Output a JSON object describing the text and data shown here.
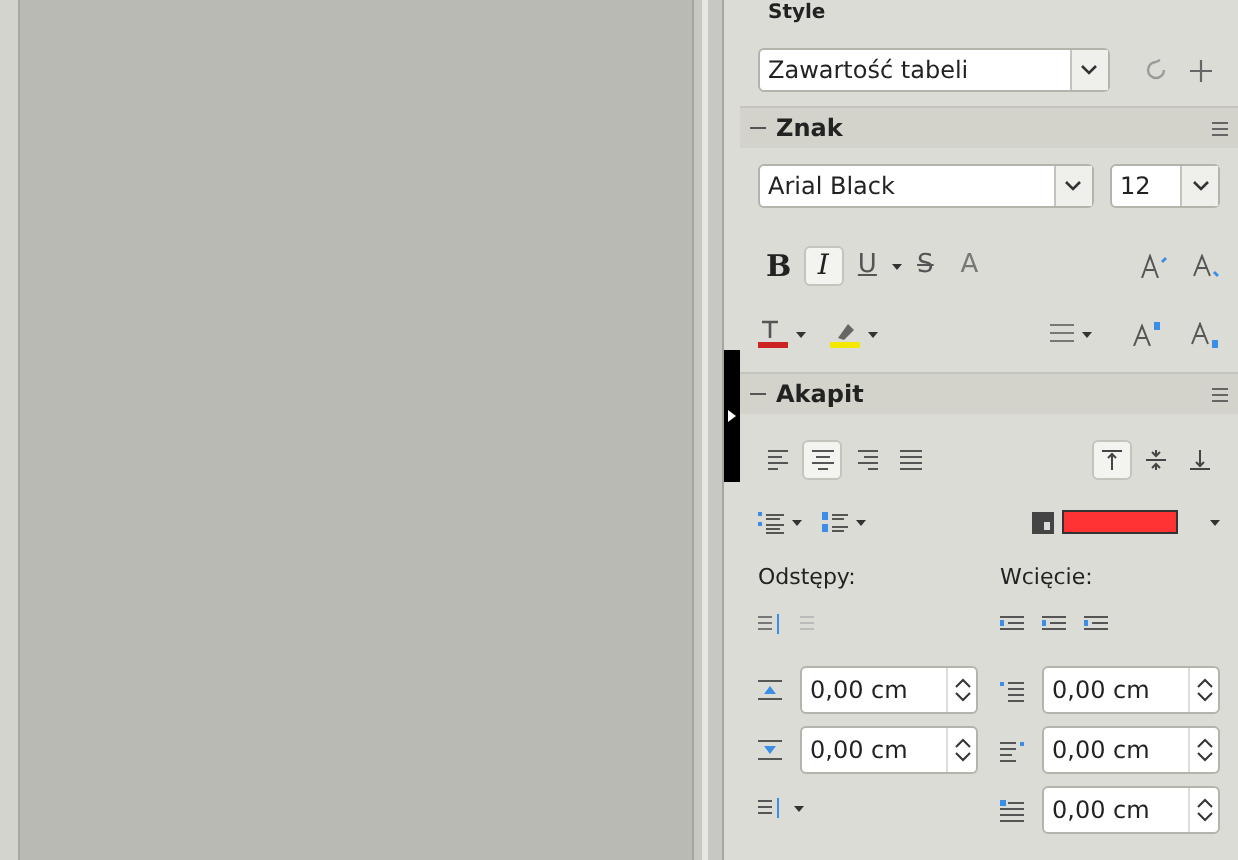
{
  "style_section": {
    "title": "Style",
    "value": "Zawartość tabeli"
  },
  "character": {
    "title": "Znak",
    "font": "Arial Black",
    "size": "12",
    "format_buttons": [
      {
        "kind": "bold",
        "label": "B",
        "selected": false
      },
      {
        "kind": "italic",
        "label": "I",
        "selected": true
      },
      {
        "kind": "underline",
        "label": "U",
        "selected": false
      },
      {
        "kind": "strike",
        "label": "S",
        "selected": false
      },
      {
        "kind": "shadow",
        "label": "A",
        "selected": false
      }
    ],
    "font_color": {
      "color": "#cc2222"
    },
    "highlight_color": {
      "color": "#f5e800"
    }
  },
  "paragraph": {
    "title": "Akapit",
    "alignment": [
      {
        "kind": "left",
        "selected": false
      },
      {
        "kind": "center",
        "selected": true
      },
      {
        "kind": "right",
        "selected": false
      },
      {
        "kind": "justify",
        "selected": false
      }
    ],
    "vertical_alignment": [
      {
        "kind": "top",
        "selected": true
      },
      {
        "kind": "middle",
        "selected": false
      },
      {
        "kind": "bottom",
        "selected": false
      }
    ],
    "background_color": {
      "color": "#ff3333"
    },
    "spacing_label": "Odstępy:",
    "indent_label": "Wcięcie:",
    "spacing_fields": [
      {
        "kind": "above",
        "value": "0,00 cm"
      },
      {
        "kind": "below",
        "value": "0,00 cm"
      }
    ],
    "indent_fields": [
      {
        "kind": "before",
        "value": "0,00 cm"
      },
      {
        "kind": "after",
        "value": "0,00 cm"
      },
      {
        "kind": "first",
        "value": "0,00 cm"
      }
    ]
  }
}
